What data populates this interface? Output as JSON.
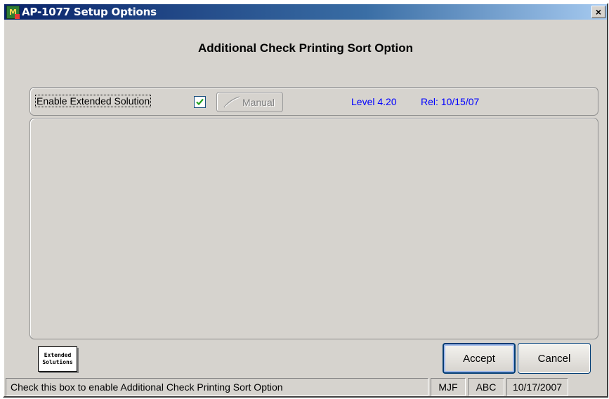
{
  "window": {
    "title": "AP-1077 Setup Options",
    "icon": "app-icon",
    "icon_glyph": "M",
    "close_label": "×",
    "title_color": "#0a246a"
  },
  "heading": "Additional Check Printing Sort Option",
  "options": {
    "enable_label": "Enable Extended Solution",
    "enable_checked": true,
    "manual_label": "Manual",
    "level": "Level 4.20",
    "release": "Rel: 10/15/07",
    "info_color": "#0000ff"
  },
  "logo": {
    "line1": "Extended",
    "line2": "Solutions"
  },
  "buttons": {
    "accept_label": "Accept",
    "cancel_label": "Cancel"
  },
  "statusbar": {
    "message": "Check this box to enable Additional Check Printing Sort Option",
    "user": "MJF",
    "company": "ABC",
    "date": "10/17/2007"
  }
}
